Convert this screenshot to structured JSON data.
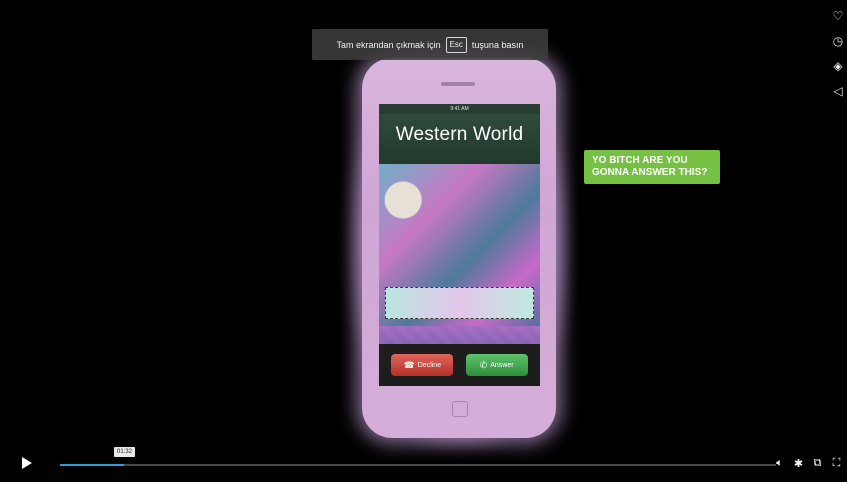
{
  "esc_notice": {
    "before": "Tam ekrandan çıkmak için",
    "key": "Esc",
    "after": "tuşuna basın"
  },
  "video_frame": {
    "caller_name": "Western World",
    "status_time": "9:41 AM",
    "decline_label": "Decline",
    "answer_label": "Answer",
    "text_bubble": "YO BITCH ARE YOU GONNA ANSWER THIS?"
  },
  "side_icons": [
    "heart-icon",
    "clock-icon",
    "layers-icon",
    "send-icon"
  ],
  "controls": {
    "current_time": "01:32",
    "progress_fraction": 0.09,
    "accent_color": "#2a9fd8",
    "icons": [
      "volume-icon",
      "settings-icon",
      "picture-in-picture-icon",
      "fullscreen-exit-icon"
    ]
  }
}
